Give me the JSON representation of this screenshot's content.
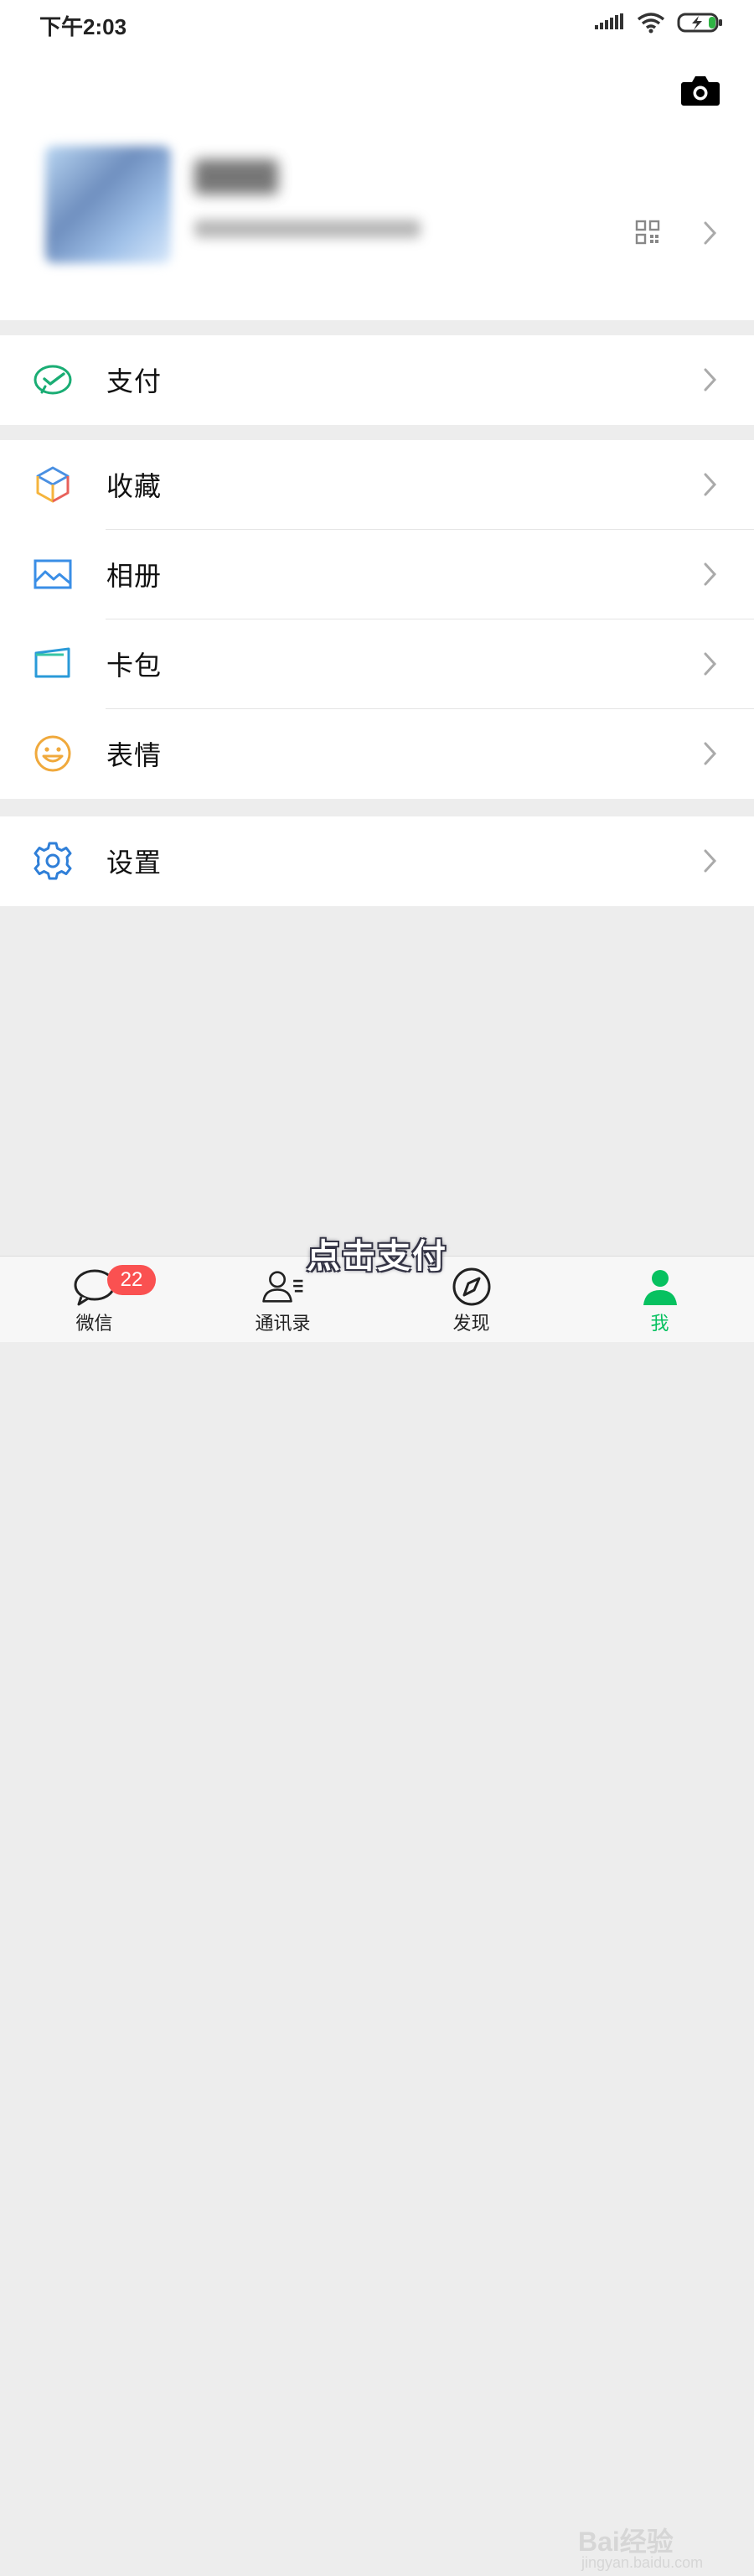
{
  "status_bar": {
    "time": "下午2:03"
  },
  "profile": {
    "name": "",
    "wechat_id": ""
  },
  "menu_groups": [
    [
      {
        "id": "pay",
        "label": "支付",
        "icon": "wechat-pay-icon"
      }
    ],
    [
      {
        "id": "favorites",
        "label": "收藏",
        "icon": "favorites-cube-icon"
      },
      {
        "id": "album",
        "label": "相册",
        "icon": "album-icon"
      },
      {
        "id": "cards",
        "label": "卡包",
        "icon": "card-wallet-icon"
      },
      {
        "id": "stickers",
        "label": "表情",
        "icon": "sticker-smile-icon"
      }
    ],
    [
      {
        "id": "settings",
        "label": "设置",
        "icon": "settings-gear-icon"
      }
    ]
  ],
  "caption": "点击支付",
  "tabbar": {
    "tabs": [
      {
        "id": "chats",
        "label": "微信",
        "badge": "22",
        "icon": "chat-bubble-icon"
      },
      {
        "id": "contacts",
        "label": "通讯录",
        "icon": "contacts-icon"
      },
      {
        "id": "discover",
        "label": "发现",
        "icon": "compass-icon"
      },
      {
        "id": "me",
        "label": "我",
        "icon": "person-icon",
        "active": true
      }
    ]
  },
  "watermark": {
    "text": "Bai",
    "brand": "经验",
    "url": "jingyan.baidu.com"
  },
  "colors": {
    "accent": "#07c160",
    "badge": "#fa5151",
    "background": "#ededed"
  }
}
